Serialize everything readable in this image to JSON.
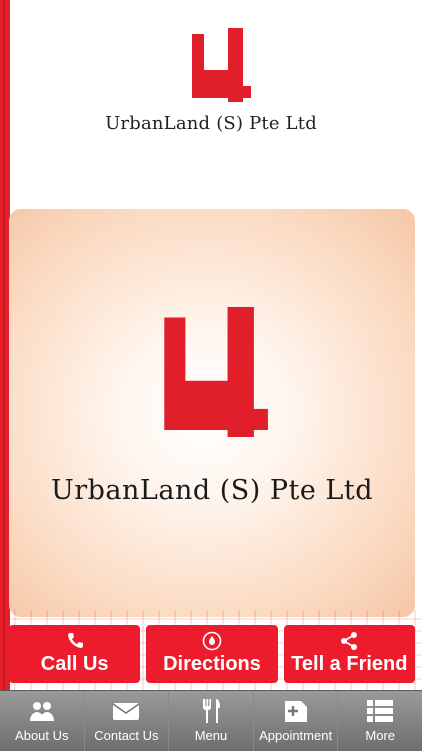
{
  "brand": {
    "company_name": "UrbanLand (S) Pte Ltd",
    "logo_letter": "u4",
    "accent_color": "#ec1c2c"
  },
  "actions": [
    {
      "label": "Call Us",
      "icon": "phone-icon"
    },
    {
      "label": "Directions",
      "icon": "location-pin-icon"
    },
    {
      "label": "Tell a Friend",
      "icon": "share-icon"
    }
  ],
  "tabbar": [
    {
      "label": "About Us",
      "icon": "people-icon"
    },
    {
      "label": "Contact Us",
      "icon": "envelope-icon"
    },
    {
      "label": "Menu",
      "icon": "fork-knife-icon"
    },
    {
      "label": "Appointment",
      "icon": "calendar-add-icon"
    },
    {
      "label": "More",
      "icon": "list-icon"
    }
  ]
}
